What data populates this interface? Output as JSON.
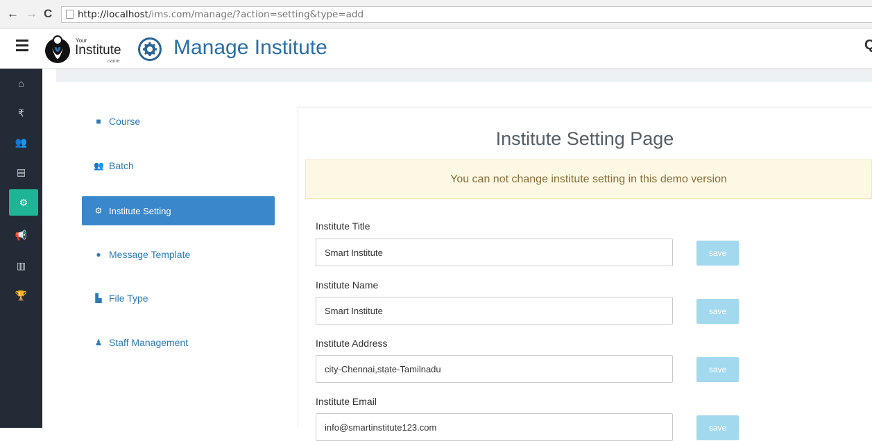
{
  "browser": {
    "url_host": "http://localhost",
    "url_path": "/ims.com/manage/?action=setting&type=add"
  },
  "header": {
    "logo_your": "Your",
    "logo_text": "Institute",
    "logo_name": "name",
    "title": "Manage Institute"
  },
  "rail": {
    "items": [
      {
        "icon": "home-icon",
        "glyph": "⌂"
      },
      {
        "icon": "rupee-icon",
        "glyph": "₹"
      },
      {
        "icon": "users-icon",
        "glyph": "👥"
      },
      {
        "icon": "file-icon",
        "glyph": "▤"
      },
      {
        "icon": "cogs-icon",
        "glyph": "⚙"
      },
      {
        "icon": "bullhorn-icon",
        "glyph": "📢"
      },
      {
        "icon": "bar-chart-icon",
        "glyph": "▥"
      },
      {
        "icon": "trophy-icon",
        "glyph": "🏆"
      }
    ]
  },
  "subnav": {
    "items": [
      {
        "label": "Course",
        "icon": "book-icon",
        "glyph": "■"
      },
      {
        "label": "Batch",
        "icon": "users-icon",
        "glyph": "👥"
      },
      {
        "label": "Institute Setting",
        "icon": "cogs-icon",
        "glyph": "⚙"
      },
      {
        "label": "Message Template",
        "icon": "comment-icon",
        "glyph": "●"
      },
      {
        "label": "File Type",
        "icon": "file-icon",
        "glyph": "▙"
      },
      {
        "label": "Staff Management",
        "icon": "user-icon",
        "glyph": "♟"
      }
    ]
  },
  "main": {
    "title": "Institute Setting Page",
    "alert": "You can not change institute setting in this demo version",
    "save_label": "save",
    "fields": [
      {
        "label": "Institute Title",
        "value": "Smart Institute"
      },
      {
        "label": "Institute Name",
        "value": "Smart Institute"
      },
      {
        "label": "Institute Address",
        "value": "city-Chennai,state-Tamilnadu"
      },
      {
        "label": "Institute Email",
        "value": "info@smartinstitute123.com"
      }
    ]
  },
  "colors": {
    "rail_bg": "#232c36",
    "rail_active": "#1fb495",
    "accent": "#3a87cc",
    "alert_bg": "#fcf8e3",
    "save_btn": "#a3d9ef"
  }
}
